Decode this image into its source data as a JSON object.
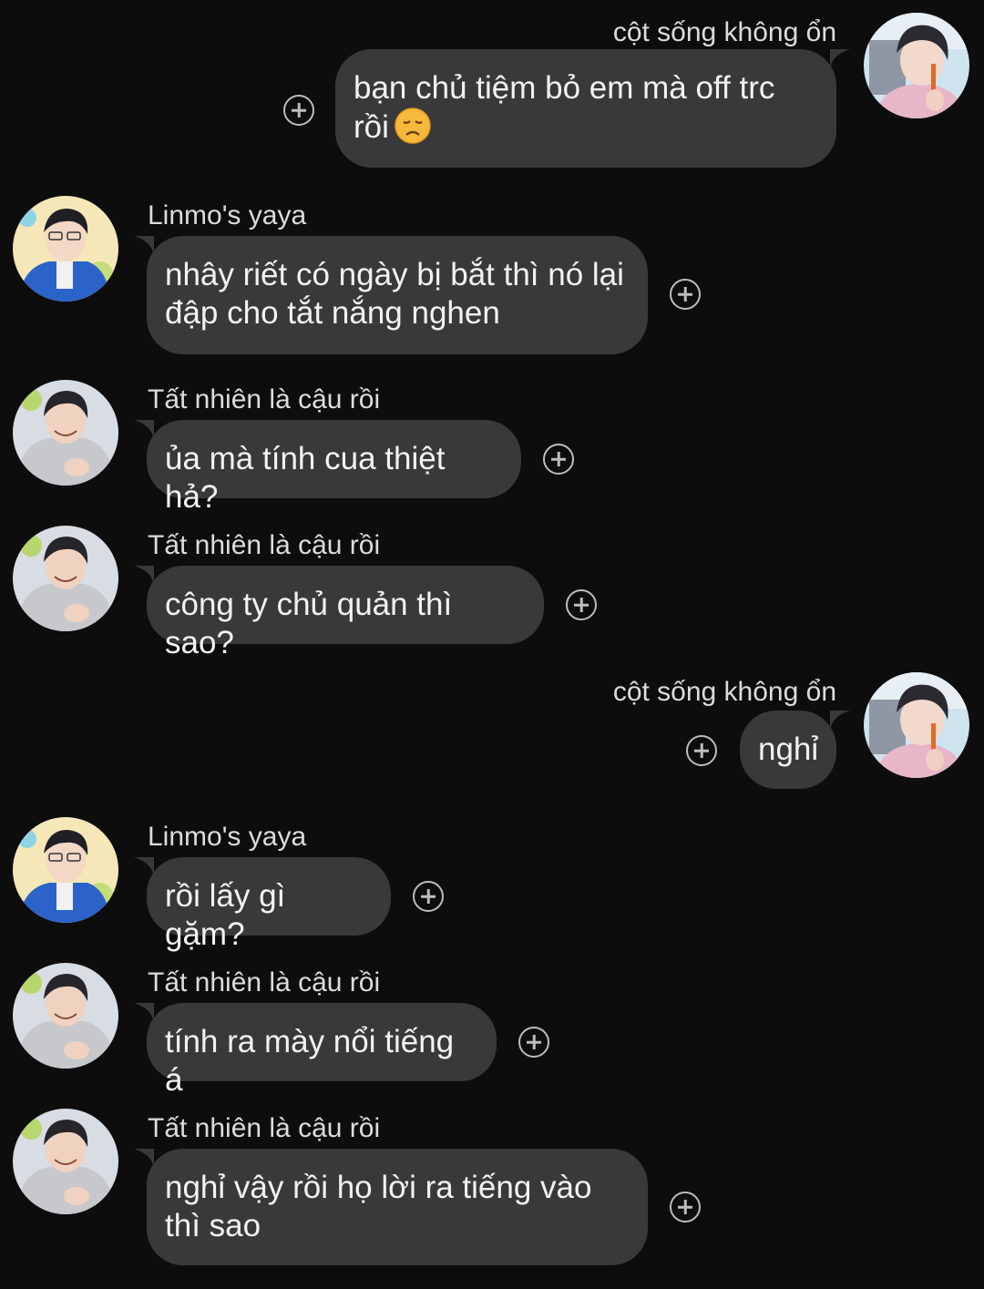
{
  "colors": {
    "background": "#0d0d0e",
    "bubble": "#39393b",
    "text": "#f2f2f2",
    "name_text": "#dcdcdc",
    "react_icon": "#bdbdbd"
  },
  "messages": [
    {
      "direction": "outgoing",
      "sender": "cột sống không ổn",
      "avatar": "user-avatar-pink-shirt",
      "text": "bạn chủ tiệm bỏ em mà off trc\nrồi",
      "emoji": "disappointed-face"
    },
    {
      "direction": "incoming",
      "sender": "Linmo's yaya",
      "avatar": "user-avatar-blue-jacket",
      "text": "nhây riết có ngày bị bắt thì nó lại\nđập cho tắt nắng nghen"
    },
    {
      "direction": "incoming",
      "sender": "Tất nhiên là cậu rồi",
      "avatar": "user-avatar-grey-hoodie",
      "text": "ủa mà tính cua thiệt hả?"
    },
    {
      "direction": "incoming",
      "sender": "Tất nhiên là cậu rồi",
      "avatar": "user-avatar-grey-hoodie",
      "text": "công ty chủ quản thì sao?"
    },
    {
      "direction": "outgoing",
      "sender": "cột sống không ổn",
      "avatar": "user-avatar-pink-shirt",
      "text": "nghỉ"
    },
    {
      "direction": "incoming",
      "sender": "Linmo's yaya",
      "avatar": "user-avatar-blue-jacket",
      "text": "rồi lấy gì gặm?"
    },
    {
      "direction": "incoming",
      "sender": "Tất nhiên là cậu rồi",
      "avatar": "user-avatar-grey-hoodie",
      "text": "tính ra mày nổi tiếng á"
    },
    {
      "direction": "incoming",
      "sender": "Tất nhiên là cậu rồi",
      "avatar": "user-avatar-grey-hoodie",
      "text": "nghỉ vậy rồi họ lời ra tiếng vào\nthì sao"
    }
  ]
}
